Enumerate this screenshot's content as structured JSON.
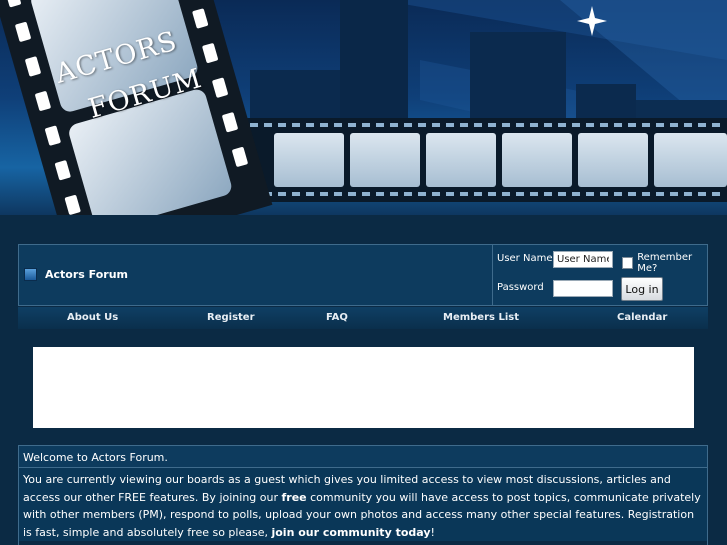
{
  "banner": {
    "logo_line1": "ACTORS",
    "logo_line2": "FORUM"
  },
  "header": {
    "forum_title": "Actors Forum"
  },
  "login": {
    "username_label": "User Name",
    "username_value": "User Name",
    "password_label": "Password",
    "remember_label": "Remember Me?",
    "login_button": "Log in"
  },
  "nav": {
    "items": [
      "About Us",
      "Register",
      "FAQ",
      "Members List",
      "Calendar"
    ]
  },
  "welcome": {
    "heading": "Welcome to Actors Forum.",
    "text_1": "You are currently viewing our boards as a guest which gives you limited access to view most discussions, articles and access our other FREE features. By joining our ",
    "text_free": "free",
    "text_2": " community you will have access to post topics, communicate privately with other members (PM), respond to polls, upload your own photos and access many other special features. Registration is fast, simple and absolutely free so please, ",
    "text_join": "join our community today",
    "text_3": "!"
  },
  "colors": {
    "page_bg": "#0b2a44",
    "panel_bg": "#0d3b5e",
    "border": "#3f6b8c"
  }
}
